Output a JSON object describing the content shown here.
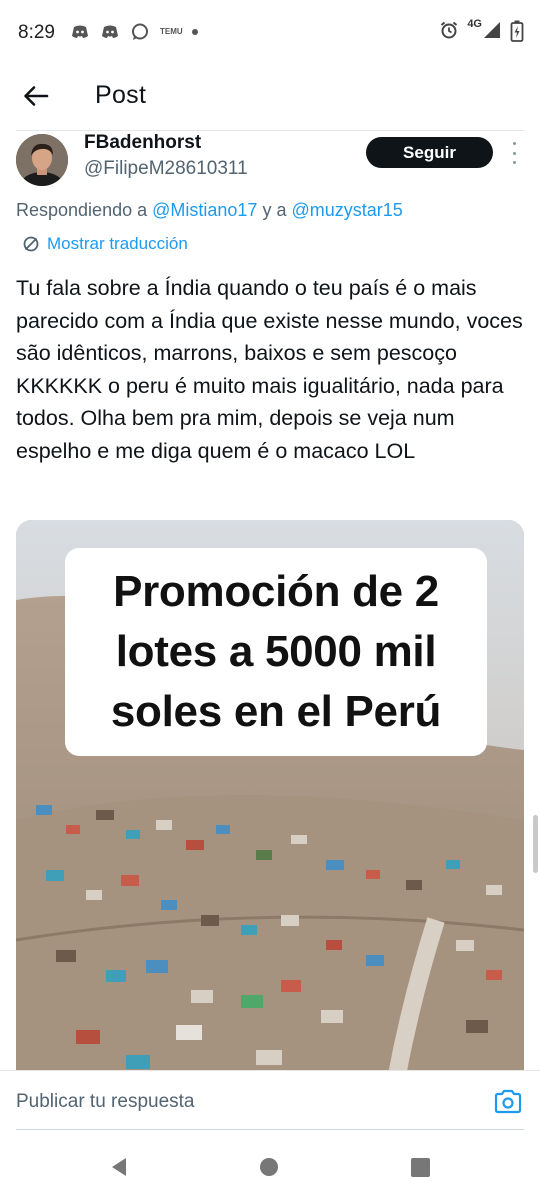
{
  "status_bar": {
    "time": "8:29",
    "temu_label": "TEMU",
    "network": "4G",
    "icons": [
      "discord-icon",
      "discord-icon",
      "chat-bubble-icon",
      "temu-icon",
      "dot-icon",
      "alarm-icon",
      "signal-icon",
      "battery-icon"
    ]
  },
  "header": {
    "title": "Post",
    "back_icon": "arrow-left-icon"
  },
  "post": {
    "display_name": "FBadenhorst",
    "handle": "@FilipeM28610311",
    "follow_label": "Seguir",
    "reply_prefix": "Respondiendo a",
    "mention_1": "@Mistiano17",
    "reply_join": "y a",
    "mention_2": "@muzystar15",
    "translate_label": "Mostrar traducción",
    "text": "Tu fala sobre a Índia quando o teu país é o mais parecido com a Índia que existe nesse mundo, voces são idênticos, marrons, baixos e sem pescoço KKKKKK o peru é muito mais igualitário, nada para todos. Olha bem pra mim, depois se veja num espelho e me diga quem é o macaco LOL",
    "media_caption": "Promoción de 2 lotes a 5000 mil soles en el Perú"
  },
  "reply_bar": {
    "placeholder": "Publicar tu respuesta",
    "camera_icon": "camera-icon"
  },
  "nav_bar": {
    "icons": [
      "nav-back-icon",
      "nav-home-icon",
      "nav-recents-icon"
    ]
  },
  "colors": {
    "accent": "#1d9bf0",
    "text": "#0f1419",
    "secondary": "#536471",
    "follow_bg": "#0f1419"
  }
}
